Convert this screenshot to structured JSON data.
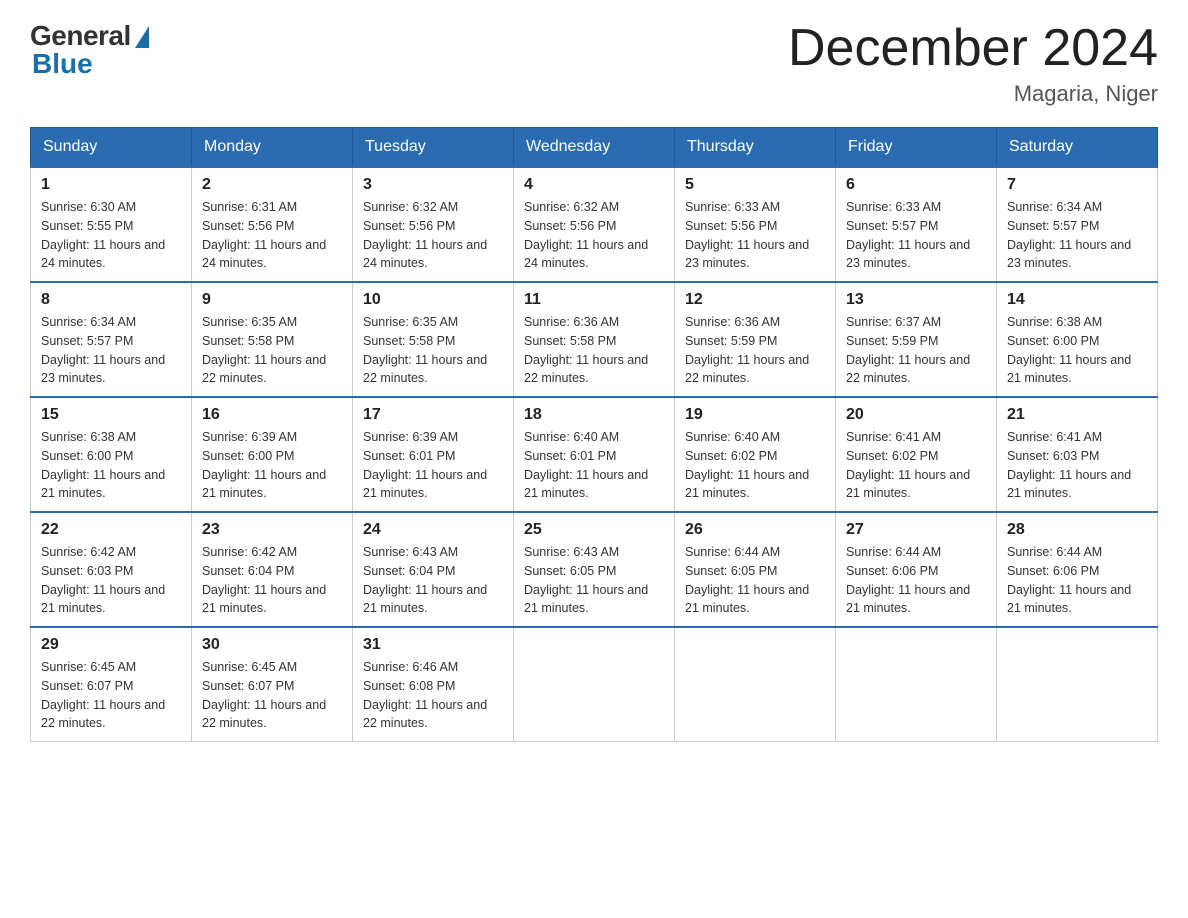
{
  "logo": {
    "general": "General",
    "blue": "Blue"
  },
  "title": "December 2024",
  "location": "Magaria, Niger",
  "days_of_week": [
    "Sunday",
    "Monday",
    "Tuesday",
    "Wednesday",
    "Thursday",
    "Friday",
    "Saturday"
  ],
  "weeks": [
    [
      {
        "day": "1",
        "sunrise": "6:30 AM",
        "sunset": "5:55 PM",
        "daylight": "11 hours and 24 minutes."
      },
      {
        "day": "2",
        "sunrise": "6:31 AM",
        "sunset": "5:56 PM",
        "daylight": "11 hours and 24 minutes."
      },
      {
        "day": "3",
        "sunrise": "6:32 AM",
        "sunset": "5:56 PM",
        "daylight": "11 hours and 24 minutes."
      },
      {
        "day": "4",
        "sunrise": "6:32 AM",
        "sunset": "5:56 PM",
        "daylight": "11 hours and 24 minutes."
      },
      {
        "day": "5",
        "sunrise": "6:33 AM",
        "sunset": "5:56 PM",
        "daylight": "11 hours and 23 minutes."
      },
      {
        "day": "6",
        "sunrise": "6:33 AM",
        "sunset": "5:57 PM",
        "daylight": "11 hours and 23 minutes."
      },
      {
        "day": "7",
        "sunrise": "6:34 AM",
        "sunset": "5:57 PM",
        "daylight": "11 hours and 23 minutes."
      }
    ],
    [
      {
        "day": "8",
        "sunrise": "6:34 AM",
        "sunset": "5:57 PM",
        "daylight": "11 hours and 23 minutes."
      },
      {
        "day": "9",
        "sunrise": "6:35 AM",
        "sunset": "5:58 PM",
        "daylight": "11 hours and 22 minutes."
      },
      {
        "day": "10",
        "sunrise": "6:35 AM",
        "sunset": "5:58 PM",
        "daylight": "11 hours and 22 minutes."
      },
      {
        "day": "11",
        "sunrise": "6:36 AM",
        "sunset": "5:58 PM",
        "daylight": "11 hours and 22 minutes."
      },
      {
        "day": "12",
        "sunrise": "6:36 AM",
        "sunset": "5:59 PM",
        "daylight": "11 hours and 22 minutes."
      },
      {
        "day": "13",
        "sunrise": "6:37 AM",
        "sunset": "5:59 PM",
        "daylight": "11 hours and 22 minutes."
      },
      {
        "day": "14",
        "sunrise": "6:38 AM",
        "sunset": "6:00 PM",
        "daylight": "11 hours and 21 minutes."
      }
    ],
    [
      {
        "day": "15",
        "sunrise": "6:38 AM",
        "sunset": "6:00 PM",
        "daylight": "11 hours and 21 minutes."
      },
      {
        "day": "16",
        "sunrise": "6:39 AM",
        "sunset": "6:00 PM",
        "daylight": "11 hours and 21 minutes."
      },
      {
        "day": "17",
        "sunrise": "6:39 AM",
        "sunset": "6:01 PM",
        "daylight": "11 hours and 21 minutes."
      },
      {
        "day": "18",
        "sunrise": "6:40 AM",
        "sunset": "6:01 PM",
        "daylight": "11 hours and 21 minutes."
      },
      {
        "day": "19",
        "sunrise": "6:40 AM",
        "sunset": "6:02 PM",
        "daylight": "11 hours and 21 minutes."
      },
      {
        "day": "20",
        "sunrise": "6:41 AM",
        "sunset": "6:02 PM",
        "daylight": "11 hours and 21 minutes."
      },
      {
        "day": "21",
        "sunrise": "6:41 AM",
        "sunset": "6:03 PM",
        "daylight": "11 hours and 21 minutes."
      }
    ],
    [
      {
        "day": "22",
        "sunrise": "6:42 AM",
        "sunset": "6:03 PM",
        "daylight": "11 hours and 21 minutes."
      },
      {
        "day": "23",
        "sunrise": "6:42 AM",
        "sunset": "6:04 PM",
        "daylight": "11 hours and 21 minutes."
      },
      {
        "day": "24",
        "sunrise": "6:43 AM",
        "sunset": "6:04 PM",
        "daylight": "11 hours and 21 minutes."
      },
      {
        "day": "25",
        "sunrise": "6:43 AM",
        "sunset": "6:05 PM",
        "daylight": "11 hours and 21 minutes."
      },
      {
        "day": "26",
        "sunrise": "6:44 AM",
        "sunset": "6:05 PM",
        "daylight": "11 hours and 21 minutes."
      },
      {
        "day": "27",
        "sunrise": "6:44 AM",
        "sunset": "6:06 PM",
        "daylight": "11 hours and 21 minutes."
      },
      {
        "day": "28",
        "sunrise": "6:44 AM",
        "sunset": "6:06 PM",
        "daylight": "11 hours and 21 minutes."
      }
    ],
    [
      {
        "day": "29",
        "sunrise": "6:45 AM",
        "sunset": "6:07 PM",
        "daylight": "11 hours and 22 minutes."
      },
      {
        "day": "30",
        "sunrise": "6:45 AM",
        "sunset": "6:07 PM",
        "daylight": "11 hours and 22 minutes."
      },
      {
        "day": "31",
        "sunrise": "6:46 AM",
        "sunset": "6:08 PM",
        "daylight": "11 hours and 22 minutes."
      },
      null,
      null,
      null,
      null
    ]
  ]
}
